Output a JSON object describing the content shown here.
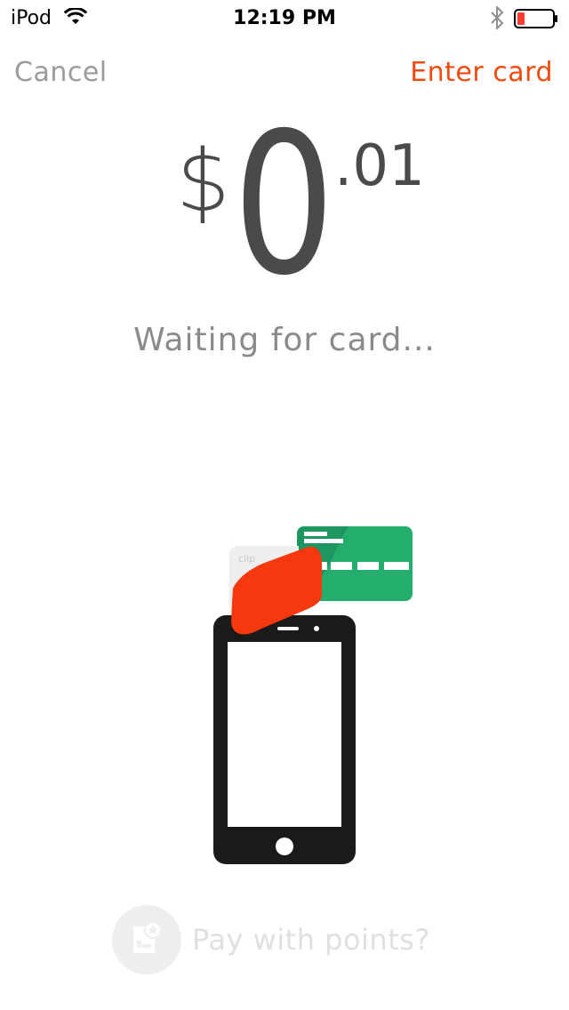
{
  "status_bar": {
    "carrier": "iPod",
    "time": "12:19 PM",
    "wifi_icon": "wifi-icon",
    "bluetooth_icon": "bluetooth-icon",
    "battery_icon": "battery-low-icon",
    "battery_color": "#ff3b30"
  },
  "nav": {
    "cancel_label": "Cancel",
    "enter_card_label": "Enter card"
  },
  "amount": {
    "currency": "$",
    "integer": "0",
    "decimal": ".01"
  },
  "status_message": "Waiting for card...",
  "reader": {
    "brand": "clip",
    "reader_color": "#f5380d",
    "card_color": "#25ad6e",
    "phone_color": "#1a1a1a"
  },
  "points": {
    "label": "Pay with points?",
    "icon": "points-card-icon"
  },
  "colors": {
    "accent": "#f04a0f",
    "muted": "#9b9b9b",
    "text": "#4a4a4a"
  }
}
